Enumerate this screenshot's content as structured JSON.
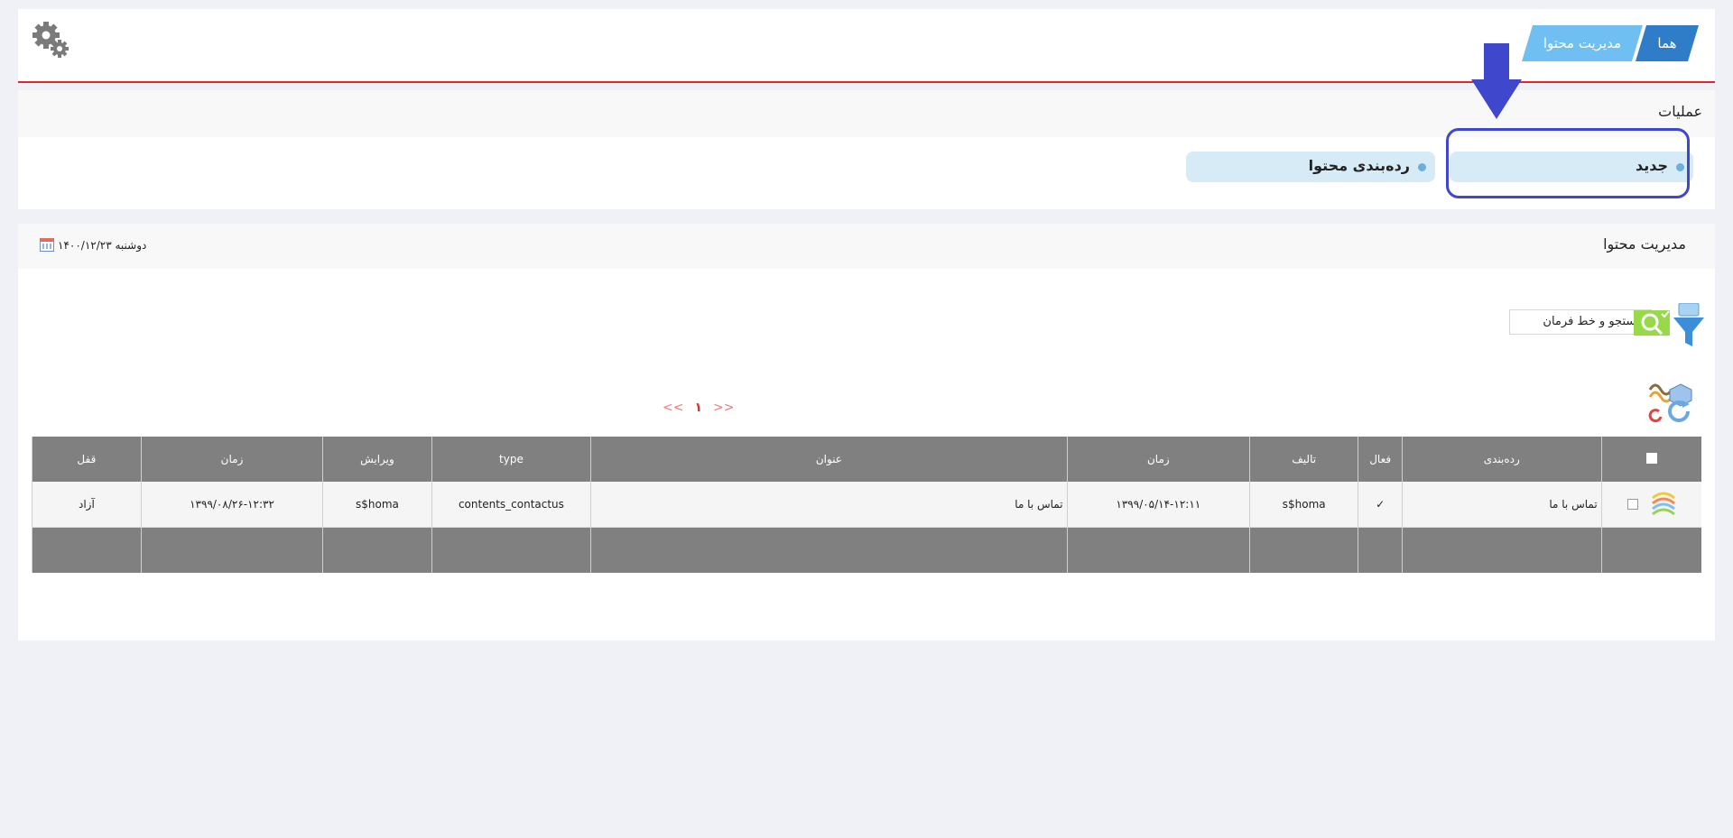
{
  "breadcrumb": {
    "home": "هما",
    "current": "مدیریت محتوا"
  },
  "operations": {
    "title": "عملیات",
    "new_label": "جدید",
    "category_label": "رده‌بندی محتوا"
  },
  "content": {
    "title": "مدیریت محتوا",
    "date": "دوشنبه ۱۴۰۰/۱۲/۲۳",
    "search_label": "جستجو و خط فرمان",
    "pager": {
      "prev": "<<",
      "current": "۱",
      "next": ">>"
    }
  },
  "table": {
    "columns": {
      "category": "رده‌بندی",
      "active": "فعال",
      "author": "تالیف",
      "time": "زمان",
      "title": "عنوان",
      "type": "type",
      "editor": "ویرایش",
      "edit_time": "زمان",
      "lock": "قفل"
    },
    "rows": [
      {
        "category": "تماس با ما",
        "active": "✓",
        "author": "s$homa",
        "time": "۱۳۹۹/۰۵/۱۴-۱۲:۱۱",
        "title": "تماس با ما",
        "type": "contents_contactus",
        "editor": "s$homa",
        "edit_time": "۱۳۹۹/۰۸/۲۶-۱۲:۳۲",
        "lock": "آزاد"
      }
    ]
  },
  "colors": {
    "accent_red": "#e0262b",
    "breadcrumb_dark": "#2f7cc8",
    "breadcrumb_light": "#70bff2",
    "highlight": "#3f47cc",
    "table_header": "#808080"
  }
}
